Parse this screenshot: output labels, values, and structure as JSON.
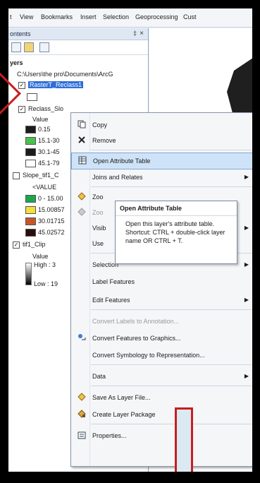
{
  "menubar": {
    "items": [
      "t",
      "View",
      "Bookmarks",
      "Insert",
      "Selection",
      "Geoprocessing",
      "Cust"
    ]
  },
  "toc": {
    "title": "ontents",
    "pin": "‡",
    "close": "×",
    "group": "yers",
    "path": "C:\\Users\\the pro\\Documents\\ArcG",
    "layers": [
      {
        "label": "RasterT_Reclass1",
        "selected": true
      },
      {
        "label": "Reclass_Slo"
      },
      {
        "label": "Slope_tif1_C"
      },
      {
        "label": "tif1_Clip"
      }
    ],
    "reclass_legend": {
      "header": "Value",
      "classes": [
        {
          "label": "0.15",
          "color": "#1c1c1c"
        },
        {
          "label": "15.1-30",
          "color": "#4cc24c"
        },
        {
          "label": "30.1-45",
          "color": "#1c1c1c"
        },
        {
          "label": "45.1-79",
          "color": "#ffffff"
        }
      ]
    },
    "slope_legend": {
      "header": "<VALUE",
      "classes": [
        {
          "label": "0 - 15.00",
          "color": "#1aa84a"
        },
        {
          "label": "15.00857",
          "color": "#f2e13a"
        },
        {
          "label": "30.01715",
          "color": "#c8552a"
        },
        {
          "label": "45.02572",
          "color": "#2a0d0d"
        }
      ]
    },
    "clip_legend": {
      "header": "Value",
      "high": "High : 3",
      "low": "Low : 19"
    }
  },
  "context_menu": {
    "items": [
      {
        "label": "Copy",
        "icon": "copy-icon"
      },
      {
        "label": "Remove",
        "icon": "remove-icon"
      },
      {
        "label": "Open Attribute Table",
        "icon": "table-icon",
        "highlight": true
      },
      {
        "label": "Joins and Relates",
        "submenu": true
      },
      {
        "label": "Zoo",
        "icon": "zoom-icon"
      },
      {
        "label": "Zoo",
        "icon": "zoom-icon",
        "disabled": true
      },
      {
        "label": "Visib",
        "submenu": true
      },
      {
        "label": "Use"
      },
      {
        "label": "Selection",
        "submenu": true
      },
      {
        "label": "Label Features"
      },
      {
        "label": "Edit Features",
        "submenu": true
      },
      {
        "label": "Convert Labels to Annotation...",
        "disabled": true
      },
      {
        "label": "Convert Features to Graphics...",
        "icon": "convert-icon"
      },
      {
        "label": "Convert Symbology to Representation..."
      },
      {
        "label": "Data",
        "submenu": true
      },
      {
        "label": "Save As Layer File...",
        "icon": "save-layer-icon"
      },
      {
        "label": "Create Layer Package",
        "icon": "package-icon"
      },
      {
        "label": "Properties...",
        "icon": "properties-icon"
      }
    ]
  },
  "tooltip": {
    "title": "Open Attribute Table",
    "body": "Open this layer's attribute table. Shortcut: CTRL + double-click layer name OR CTRL + T."
  },
  "colors": {
    "highlight": "#cfe3f8",
    "selected": "#2f6fd8",
    "annotation_red": "#c81d1d"
  }
}
